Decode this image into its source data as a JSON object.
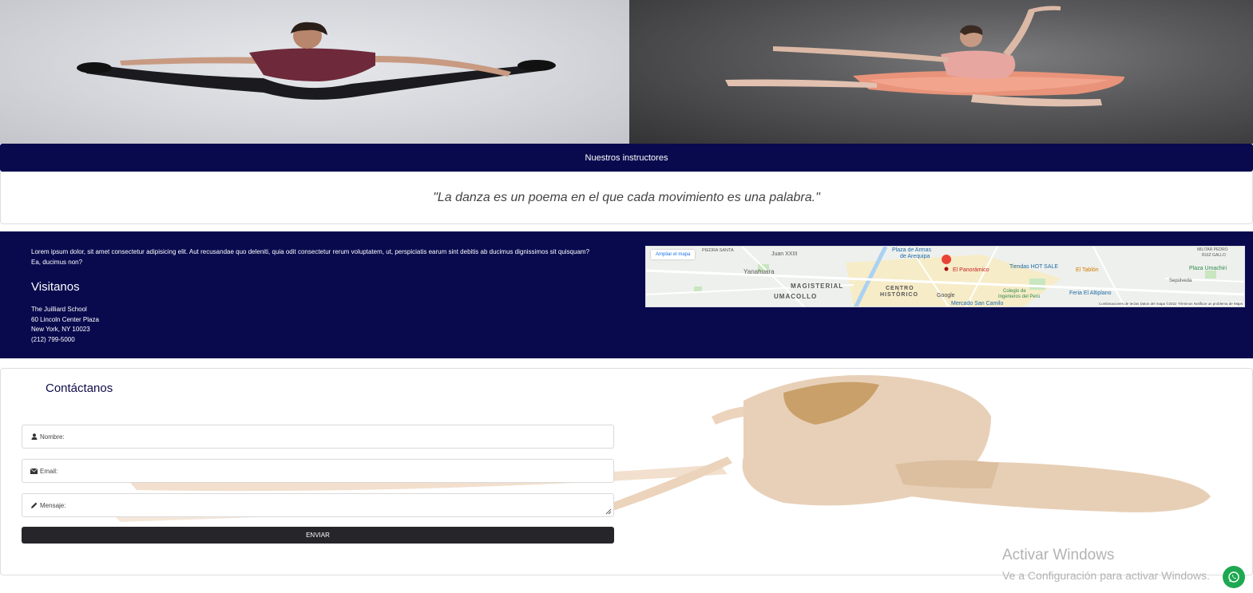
{
  "hero": {
    "left_image": "male dancer jumping split",
    "right_image": "female ballerina leaping in pink tutu"
  },
  "band": {
    "label": "Nuestros instructores"
  },
  "quote": {
    "text": "\"La danza es un poema en el que cada movimiento es una palabra.\""
  },
  "info": {
    "lorem": "Lorem ipsum dolor, sit amet consectetur adipisicing elit. Aut recusandae quo deleniti, quia odit consectetur rerum voluptatem, ut, perspiciatis earum sint debitis ab ducimus dignissimos sit quisquam? Ea, ducimus non?",
    "visit_title": "Visitanos",
    "address": [
      "The Juilliard School",
      "60 Lincoln Center Plaza",
      "New York, NY 10023",
      "(212) 799-5000"
    ]
  },
  "map": {
    "enlarge": "Ampliar el mapa",
    "labels": {
      "piedra_santa": "PIEDRA SANTA",
      "juan": "Juan XXIII",
      "plaza_armas": "Plaza de Armas",
      "plaza_armas2": "de Arequipa",
      "yanahuara": "Yanahuara",
      "magisterial": "MAGISTERIAL",
      "umacollo": "UMACOLLO",
      "centro": "CENTRO",
      "historico": "HISTÓRICO",
      "panoramico": "El Panorámico",
      "tiendas": "Tiendas HOT SALE",
      "tablon": "El Tablón",
      "umachiri": "Plaza Umachiri",
      "feria": "Feria El Altiplano",
      "colegio": "Colegio de",
      "colegio2": "Ingenieros del Perú",
      "mercado": "Mercado San Camilo",
      "militar": "MILITAR PEDRO",
      "militar2": "RUIZ GALLO",
      "sepulveda": "Sepúlveda",
      "google": "Google"
    },
    "footer": "Combinaciones de teclas   Datos del mapa ©2022   Términos   Notificar un problema de Maps"
  },
  "contact": {
    "title": "Contáctanos",
    "name_placeholder": "Nombre:",
    "email_placeholder": "Email:",
    "message_placeholder": "Mensaje:",
    "send_label": "ENVIAR"
  },
  "windows": {
    "line1": "Activar Windows",
    "line2": "Ve a Configuración para activar Windows."
  },
  "colors": {
    "navy": "#090a4e",
    "button": "#25252a",
    "whatsapp": "#1da851"
  }
}
